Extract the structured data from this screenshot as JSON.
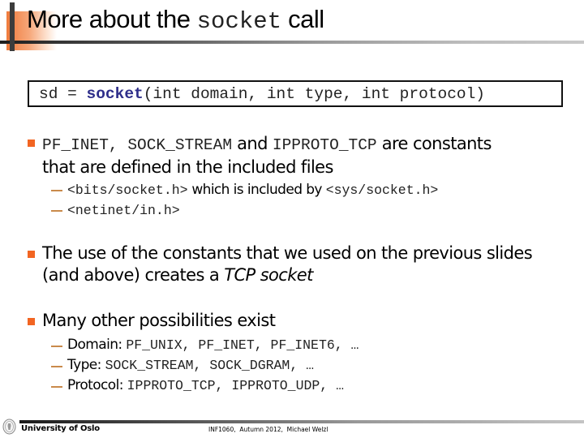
{
  "slide": {
    "title_prefix": "More about the ",
    "title_code": "socket",
    "title_suffix": " call",
    "code_line": {
      "lhs": "sd = ",
      "func": "socket",
      "args": "(int domain, int type, int protocol)"
    },
    "bullets": [
      {
        "line1": {
          "c1": "PF_INET, SOCK_STREAM",
          "t1": " and ",
          "c2": "IPPROTO_TCP",
          "t2": " are constants"
        },
        "line2": "that are defined in the included files",
        "subs": [
          {
            "c1": "<bits/socket.h>",
            "t1": " which is included by ",
            "c2": "<sys/socket.h>"
          },
          {
            "c1": "<netinet/in.h>"
          }
        ]
      },
      {
        "line1": "The use of the constants that we used on the previous slides",
        "line2_text": "(and above) creates a ",
        "line2_emph": "TCP socket"
      },
      {
        "line1": "Many other possibilities exist",
        "subs": [
          {
            "label": "Domain: ",
            "code": "PF_UNIX, PF_INET, PF_INET6, …"
          },
          {
            "label": "Type: ",
            "code": "SOCK_STREAM, SOCK_DGRAM, …"
          },
          {
            "label": "Protocol: ",
            "code": "IPPROTO_TCP, IPPROTO_UDP, …"
          }
        ]
      }
    ]
  },
  "footer": {
    "university": "University of Oslo",
    "course_info": "INF1060,  Autumn 2012,  Michael Welzl",
    "logo_icon": "university-seal-icon"
  },
  "colors": {
    "bullet": "#f26522",
    "sub_dash": "#c98a4b",
    "keyword": "#2e2e8a",
    "header_accent": "#ef7b3c"
  }
}
